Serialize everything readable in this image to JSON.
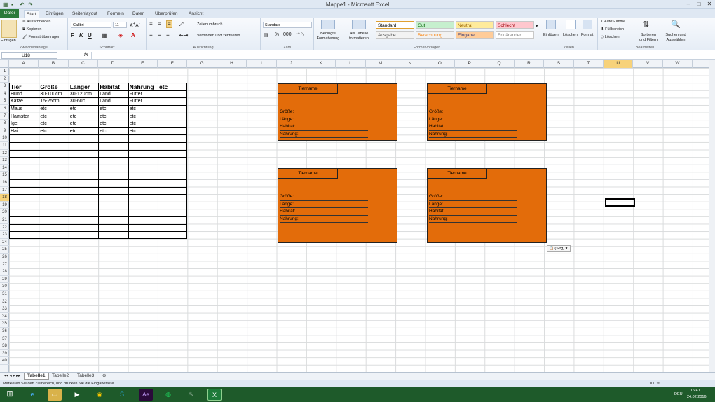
{
  "window": {
    "title": "Mappe1 - Microsoft Excel"
  },
  "ribbon_tabs": [
    "Datei",
    "Start",
    "Einfügen",
    "Seitenlayout",
    "Formeln",
    "Daten",
    "Überprüfen",
    "Ansicht"
  ],
  "clipboard": {
    "paste": "Einfügen",
    "cut": "Ausschneiden",
    "copy": "Kopieren",
    "format": "Format übertragen",
    "label": "Zwischenablage"
  },
  "font": {
    "name": "Calibri",
    "size": "11",
    "label": "Schriftart"
  },
  "alignment": {
    "wrap": "Zeilenumbruch",
    "merge": "Verbinden und zentrieren",
    "label": "Ausrichtung"
  },
  "number": {
    "format": "Standard",
    "label": "Zahl"
  },
  "styles": {
    "cond": "Bedingte Formatierung",
    "table": "Als Tabelle formatieren",
    "label": "Formatvorlagen",
    "items": [
      {
        "name": "Standard",
        "bg": "#ffffff",
        "fg": "#000000"
      },
      {
        "name": "Gut",
        "bg": "#c6efce",
        "fg": "#006100"
      },
      {
        "name": "Neutral",
        "bg": "#ffeb9c",
        "fg": "#9c6500"
      },
      {
        "name": "Schlecht",
        "bg": "#ffc7ce",
        "fg": "#9c0006"
      },
      {
        "name": "Ausgabe",
        "bg": "#f2f2f2",
        "fg": "#3f3f3f"
      },
      {
        "name": "Berechnung",
        "bg": "#f2f2f2",
        "fg": "#fa7d00"
      },
      {
        "name": "Eingabe",
        "bg": "#ffcc99",
        "fg": "#3f3f76"
      },
      {
        "name": "Erklärender ...",
        "bg": "#ffffff",
        "fg": "#7f7f7f"
      }
    ]
  },
  "cells_group": {
    "insert": "Einfügen",
    "delete": "Löschen",
    "format": "Format",
    "label": "Zellen"
  },
  "editing": {
    "autosum": "AutoSumme",
    "fill": "Füllbereich",
    "clear": "Löschen",
    "sort": "Sortieren und Filtern",
    "find": "Suchen und Auswählen",
    "label": "Bearbeiten"
  },
  "formula_bar": {
    "name_box": "U18",
    "fx": "fx",
    "value": ""
  },
  "columns": [
    "A",
    "B",
    "C",
    "D",
    "E",
    "F",
    "G",
    "H",
    "I",
    "J",
    "K",
    "L",
    "M",
    "N",
    "O",
    "P",
    "Q",
    "R",
    "S",
    "T",
    "U",
    "V",
    "W"
  ],
  "selected_column": "U",
  "rows": [
    "1",
    "2",
    "3",
    "4",
    "5",
    "6",
    "7",
    "8",
    "9",
    "10",
    "11",
    "12",
    "13",
    "14",
    "15",
    "16",
    "17",
    "18",
    "19",
    "20",
    "21",
    "22",
    "23",
    "24",
    "25",
    "26",
    "27",
    "28",
    "29",
    "30",
    "31",
    "32",
    "33",
    "34",
    "35",
    "36",
    "37",
    "38",
    "39",
    "40"
  ],
  "selected_row": "18",
  "table": {
    "headers": [
      "Tier",
      "Größe",
      "Länger",
      "Habitat",
      "Nahrung",
      "etc"
    ],
    "rows": [
      [
        "Hund",
        "30-100cm",
        "30-120cm",
        "Land",
        "Futter",
        ""
      ],
      [
        "Katze",
        "15-25cm",
        "30-60c,",
        "Land",
        "Futter",
        ""
      ],
      [
        "Maus",
        "etc",
        "etc",
        "etc",
        "etc",
        ""
      ],
      [
        "Hamster",
        "etc",
        "etc",
        "etc",
        "etc",
        ""
      ],
      [
        "Igel",
        "etc",
        "etc",
        "etc",
        "etc",
        ""
      ],
      [
        "Hai",
        "etc",
        "etc",
        "etc",
        "etc",
        ""
      ]
    ]
  },
  "cards": [
    {
      "title": "Tiername",
      "labels": [
        "Größe:",
        "Länge:",
        "Habitat:",
        "Nahrung:"
      ]
    },
    {
      "title": "Tiername",
      "labels": [
        "Größe:",
        "Länge:",
        "Habitat:",
        "Nahrung:"
      ]
    },
    {
      "title": "Tiername",
      "labels": [
        "Größe:",
        "Länge:",
        "Habitat:",
        "Nahrung:"
      ]
    },
    {
      "title": "Tiername",
      "labels": [
        "Größe:",
        "Länge:",
        "Habitat:",
        "Nahrung:"
      ]
    }
  ],
  "card_color": "#e36c0a",
  "paste_options": "(Strg)",
  "sheets": [
    "Tabelle1",
    "Tabelle2",
    "Tabelle3"
  ],
  "status": {
    "message": "Markieren Sie den Zielbereich, und drücken Sie die Eingabetaste.",
    "zoom": "100 %"
  },
  "taskbar": {
    "lang": "DEU",
    "time": "16:41",
    "date": "24.02.2016"
  }
}
